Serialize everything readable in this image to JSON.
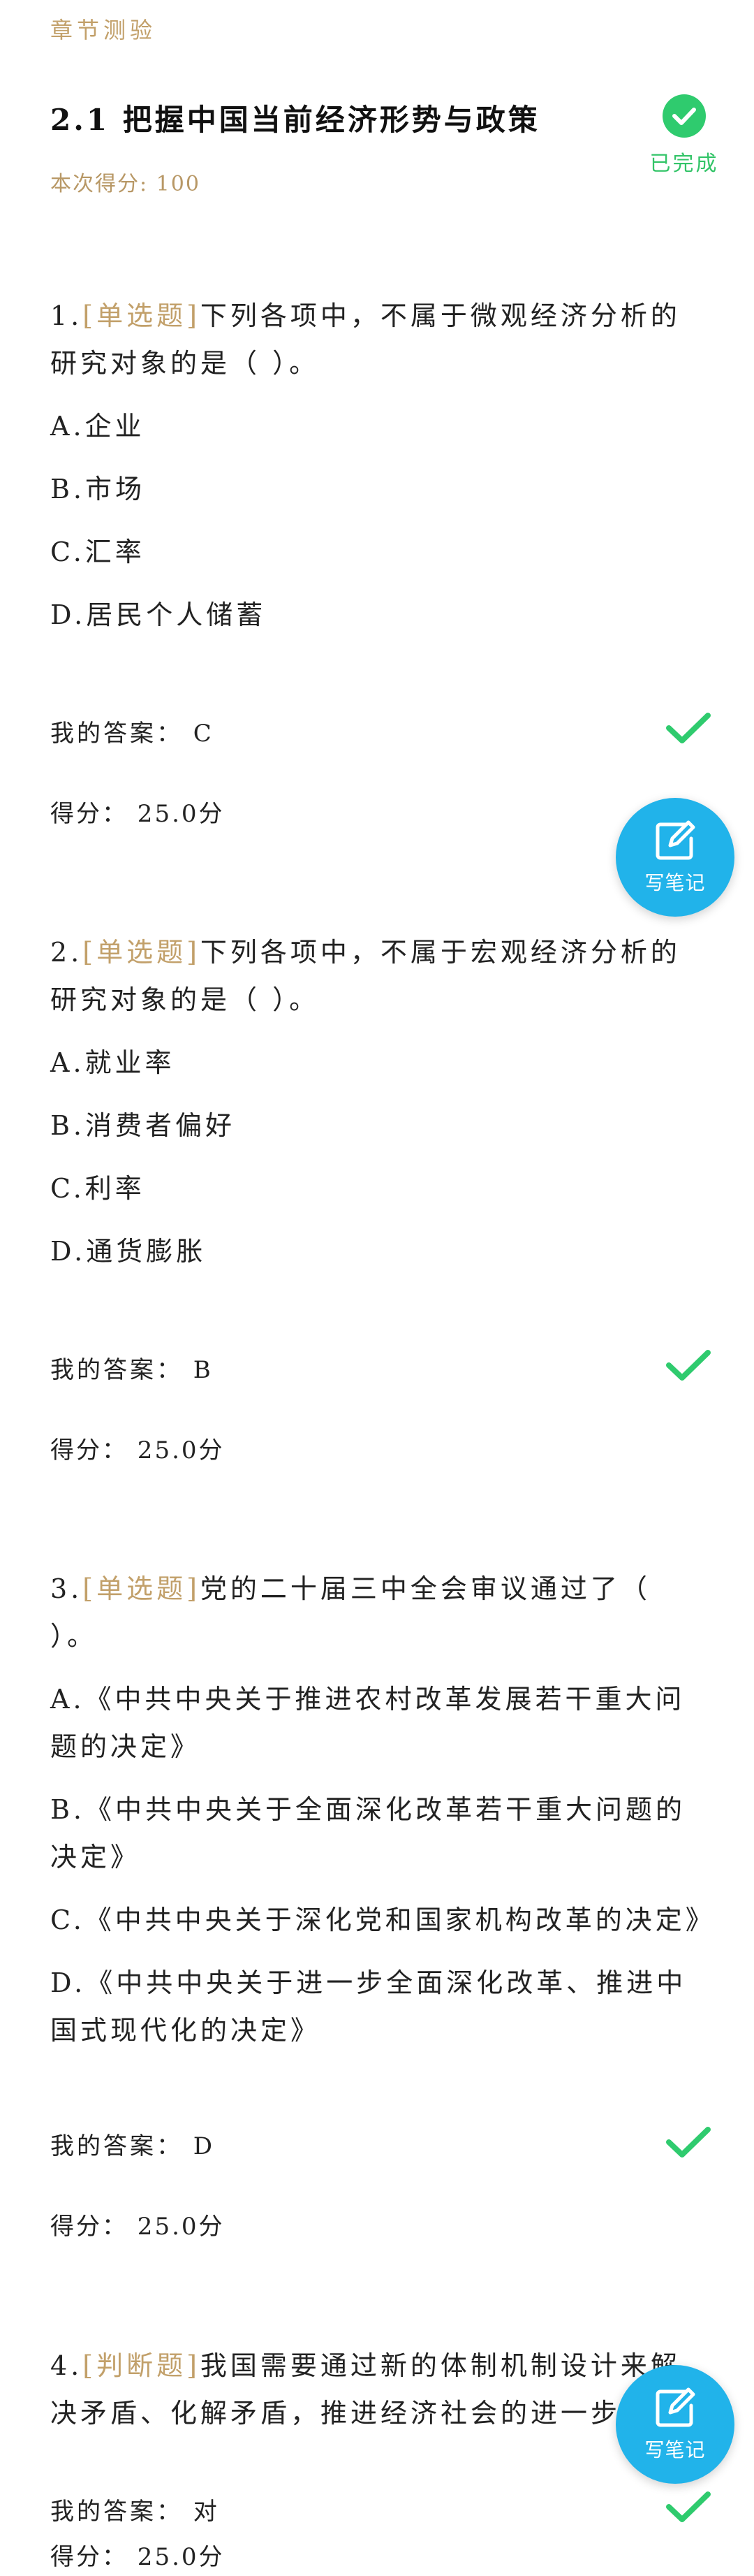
{
  "header": {
    "breadcrumb": "章节测验",
    "title": "2.1 把握中国当前经济形势与政策",
    "score_text": "本次得分: 100",
    "status_label": "已完成"
  },
  "questions": [
    {
      "number": "1.",
      "type": "[单选题]",
      "stem": "下列各项中，不属于微观经济分析的研究对象的是（ ）。",
      "options": [
        "A.企业",
        "B.市场",
        "C.汇率",
        "D.居民个人储蓄"
      ],
      "my_answer": "我的答案： C",
      "score": "得分： 25.0分"
    },
    {
      "number": "2.",
      "type": "[单选题]",
      "stem": "下列各项中，不属于宏观经济分析的研究对象的是（ ）。",
      "options": [
        "A.就业率",
        "B.消费者偏好",
        "C.利率",
        "D.通货膨胀"
      ],
      "my_answer": "我的答案： B",
      "score": "得分： 25.0分"
    },
    {
      "number": "3.",
      "type": "[单选题]",
      "stem": "党的二十届三中全会审议通过了（ ）。",
      "options": [
        "A.《中共中央关于推进农村改革发展若干重大问题的决定》",
        "B.《中共中央关于全面深化改革若干重大问题的决定》",
        "C.《中共中央关于深化党和国家机构改革的决定》",
        "D.《中共中央关于进一步全面深化改革、推进中国式现代化的决定》"
      ],
      "my_answer": "我的答案： D",
      "score": "得分： 25.0分"
    },
    {
      "number": "4.",
      "type": "[判断题]",
      "stem": "我国需要通过新的体制机制设计来解决矛盾、化解矛盾，推进经济社会的进一步发",
      "options": [],
      "my_answer": "我的答案： 对",
      "score": "得分： 25.0分"
    }
  ],
  "note_button": {
    "label": "写笔记"
  },
  "colors": {
    "accent_gold": "#c2a06a",
    "success_green": "#2fcb6e",
    "note_blue": "#21b3ea"
  },
  "icons": {
    "completed": "check-circle-icon",
    "correct": "check-icon",
    "note": "edit-note-icon"
  }
}
